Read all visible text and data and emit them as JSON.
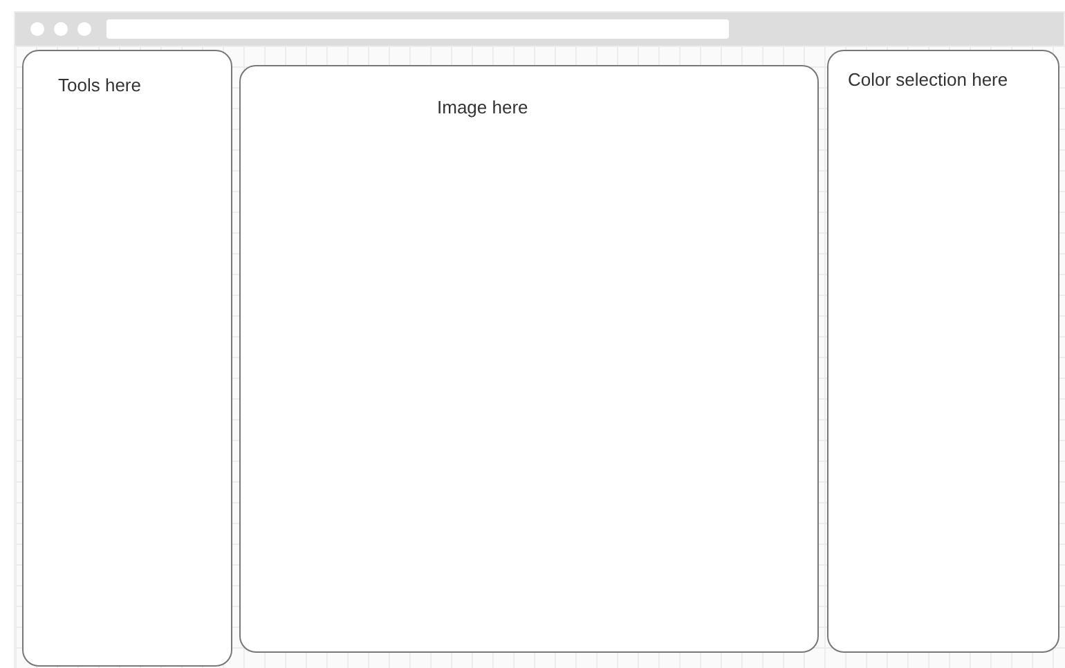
{
  "panels": [
    {
      "kind": "tools",
      "label": "Tools here"
    },
    {
      "kind": "image",
      "label": "Image here"
    },
    {
      "kind": "color",
      "label": "Color selection here"
    }
  ]
}
